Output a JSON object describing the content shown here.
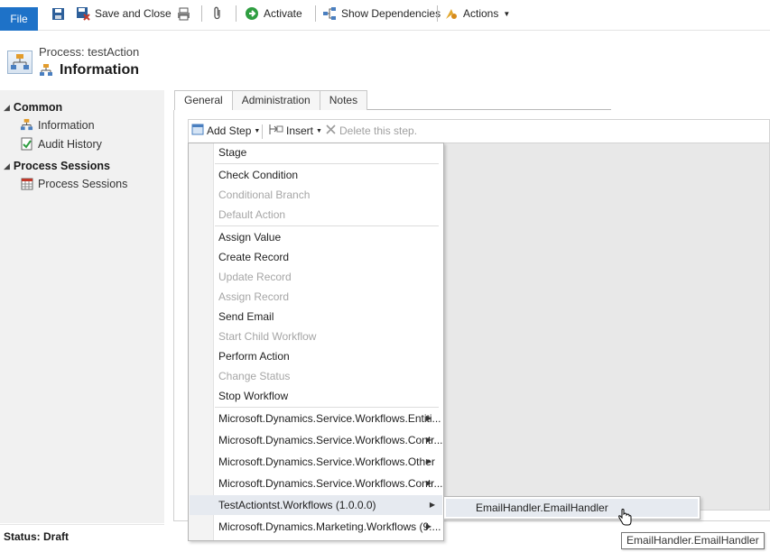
{
  "ribbon": {
    "file_label": "File",
    "save_close_label": "Save and Close",
    "activate_label": "Activate",
    "show_dependencies_label": "Show Dependencies",
    "actions_label": "Actions"
  },
  "header": {
    "subtitle": "Process: testAction",
    "title": "Information"
  },
  "leftnav": {
    "groups": [
      {
        "label": "Common",
        "items": [
          {
            "label": "Information",
            "icon": "process-icon"
          },
          {
            "label": "Audit History",
            "icon": "audit-icon"
          }
        ]
      },
      {
        "label": "Process Sessions",
        "items": [
          {
            "label": "Process Sessions",
            "icon": "grid-icon"
          }
        ]
      }
    ]
  },
  "tabs": [
    "General",
    "Administration",
    "Notes"
  ],
  "designer_toolbar": {
    "add_step_label": "Add Step",
    "insert_label": "Insert",
    "delete_label": "Delete this step."
  },
  "menu": {
    "items": [
      {
        "label": "Stage",
        "disabled": false
      },
      {
        "label": "Check Condition",
        "disabled": false
      },
      {
        "label": "Conditional Branch",
        "disabled": true
      },
      {
        "label": "Default Action",
        "disabled": true
      },
      {
        "label": "Assign Value",
        "disabled": false
      },
      {
        "label": "Create Record",
        "disabled": false
      },
      {
        "label": "Update Record",
        "disabled": true
      },
      {
        "label": "Assign Record",
        "disabled": true
      },
      {
        "label": "Send Email",
        "disabled": false
      },
      {
        "label": "Start Child Workflow",
        "disabled": true
      },
      {
        "label": "Perform Action",
        "disabled": false
      },
      {
        "label": "Change Status",
        "disabled": true
      },
      {
        "label": "Stop Workflow",
        "disabled": false
      },
      {
        "label": "Microsoft.Dynamics.Service.Workflows.Entiti...",
        "disabled": false
      },
      {
        "label": "Microsoft.Dynamics.Service.Workflows.Contr...",
        "disabled": false
      },
      {
        "label": "Microsoft.Dynamics.Service.Workflows.Other",
        "disabled": false
      },
      {
        "label": "Microsoft.Dynamics.Service.Workflows.Contr...",
        "disabled": false
      },
      {
        "label": "TestActiontst.Workflows (1.0.0.0)",
        "disabled": false
      },
      {
        "label": "Microsoft.Dynamics.Marketing.Workflows (9....",
        "disabled": false
      }
    ]
  },
  "submenu": {
    "item_label": "EmailHandler.EmailHandler"
  },
  "tooltip": {
    "text": "EmailHandler.EmailHandler"
  },
  "status": {
    "text": "Status: Draft"
  },
  "colors": {
    "file_blue": "#1e72c8",
    "menu_highlight": "#e6eaf0",
    "designer_gray": "#e8e8e8"
  }
}
